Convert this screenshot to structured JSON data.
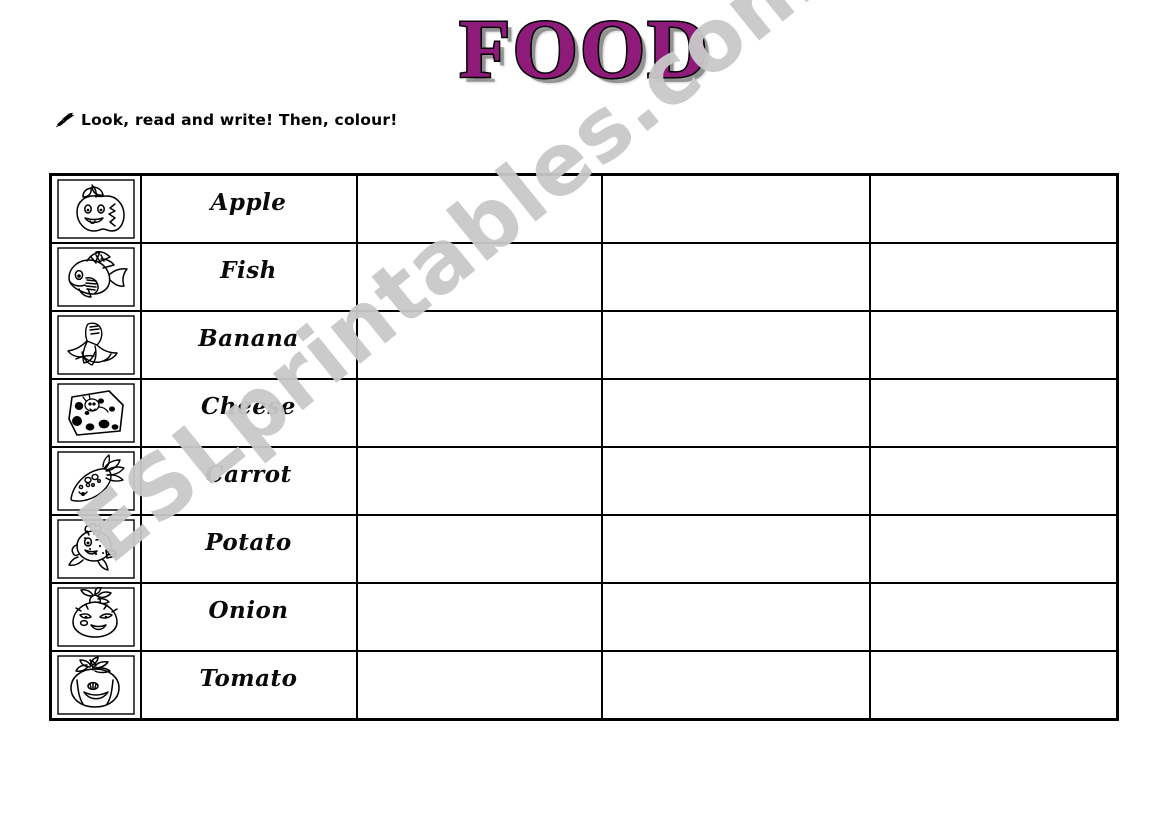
{
  "page": {
    "title": "FOOD",
    "title_color": "#8e1a7a",
    "background_color": "#ffffff"
  },
  "instruction": {
    "icon": "writing-hand-icon",
    "text": "Look, read and write! Then, colour!"
  },
  "watermark": {
    "text": "ESLprintables.com",
    "color": "#c9c9c9",
    "rotation_deg": -39
  },
  "table": {
    "column_count": 5,
    "row_count": 8,
    "columns": [
      {
        "name": "picture",
        "label": ""
      },
      {
        "name": "word",
        "label": ""
      },
      {
        "name": "blank-1",
        "label": ""
      },
      {
        "name": "blank-2",
        "label": ""
      },
      {
        "name": "blank-3",
        "label": ""
      }
    ],
    "rows": [
      {
        "picture": "apple-icon",
        "word": "Apple",
        "blank1": "",
        "blank2": "",
        "blank3": ""
      },
      {
        "picture": "fish-icon",
        "word": "Fish",
        "blank1": "",
        "blank2": "",
        "blank3": ""
      },
      {
        "picture": "banana-icon",
        "word": "Banana",
        "blank1": "",
        "blank2": "",
        "blank3": ""
      },
      {
        "picture": "cheese-icon",
        "word": "Cheese",
        "blank1": "",
        "blank2": "",
        "blank3": ""
      },
      {
        "picture": "carrot-icon",
        "word": "Carrot",
        "blank1": "",
        "blank2": "",
        "blank3": ""
      },
      {
        "picture": "potato-icon",
        "word": "Potato",
        "blank1": "",
        "blank2": "",
        "blank3": ""
      },
      {
        "picture": "onion-icon",
        "word": "Onion",
        "blank1": "",
        "blank2": "",
        "blank3": ""
      },
      {
        "picture": "tomato-icon",
        "word": "Tomato",
        "blank1": "",
        "blank2": "",
        "blank3": ""
      }
    ]
  }
}
